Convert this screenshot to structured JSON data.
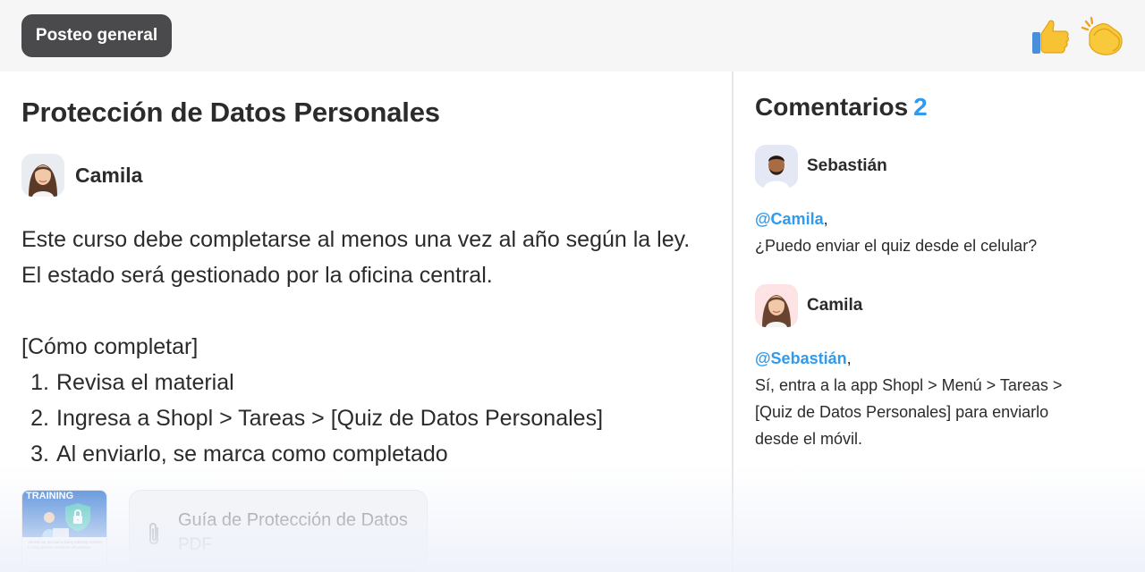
{
  "header": {
    "chip_label": "Posteo general",
    "reactions": [
      "thumbs-up-icon",
      "clapping-hands-icon"
    ]
  },
  "post": {
    "title": "Protección de Datos Personales",
    "author": "Camila",
    "paragraph_line1": "Este curso debe completarse al menos una vez al año según la ley.",
    "paragraph_line2": "El estado será gestionado por la oficina central.",
    "section_heading": "[Cómo completar]",
    "steps": [
      {
        "num": "1.",
        "text": "Revisa el material"
      },
      {
        "num": "2.",
        "text": "Ingresa a Shopl > Tareas > [Quiz de Datos Personales]"
      },
      {
        "num": "3.",
        "text": "Al enviarlo, se marca como completado"
      }
    ],
    "thumbnail": {
      "badge": "TRAINING",
      "caption": "Attend our annual privacy training session to help protect sensitive information."
    },
    "attachment": {
      "name": "Guía de Protección de Datos",
      "type": "PDF"
    }
  },
  "comments": {
    "title": "Comentarios",
    "count": "2",
    "items": [
      {
        "author": "Sebastián",
        "mention": "@Camila",
        "punct": ",",
        "lines": [
          "¿Puedo enviar el quiz desde el celular?"
        ]
      },
      {
        "author": "Camila",
        "mention": "@Sebastián",
        "punct": ",",
        "lines": [
          "Sí, entra a la app Shopl > Menú > Tareas >",
          "[Quiz de Datos Personales] para enviarlo",
          "desde el móvil."
        ]
      }
    ]
  },
  "colors": {
    "accent": "#2f9bf0",
    "chip_bg": "#4a4a4c",
    "text": "#2b2b2b"
  }
}
